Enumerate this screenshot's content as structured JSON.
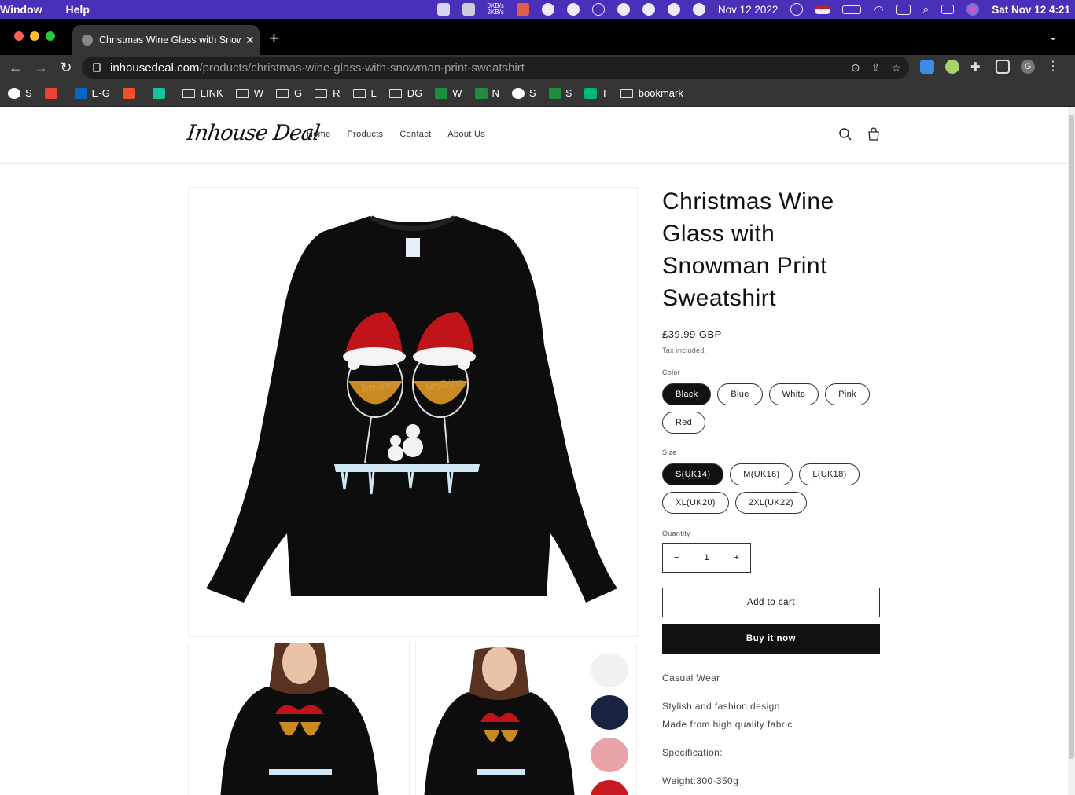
{
  "menubar": {
    "items": [
      "Window",
      "Help"
    ],
    "net_up": "0KB/s",
    "net_down": "2KB/s",
    "date_short": "Nov 12 2022",
    "clock": "Sat Nov 12  4:21"
  },
  "browser": {
    "tab_title": "Christmas Wine Glass with Snowman Print Sweatshirt",
    "tab_close": "✕",
    "new_tab": "+",
    "url_host": "inhousedeal.com",
    "url_path": "/products/christmas-wine-glass-with-snowman-print-sweatshirt",
    "profile_initial": "G",
    "bookmarks": [
      {
        "label": "S",
        "icon": "globe-icon"
      },
      {
        "label": "",
        "icon": "gmail-icon"
      },
      {
        "label": "E-G",
        "icon": "outlook-icon"
      },
      {
        "label": "",
        "icon": "microsoft-icon"
      },
      {
        "label": "",
        "icon": "grammarly-icon"
      },
      {
        "label": "LINK",
        "icon": "folder-icon"
      },
      {
        "label": "W",
        "icon": "folder-icon"
      },
      {
        "label": "G",
        "icon": "folder-icon"
      },
      {
        "label": "R",
        "icon": "folder-icon"
      },
      {
        "label": "L",
        "icon": "folder-icon"
      },
      {
        "label": "DG",
        "icon": "folder-icon"
      },
      {
        "label": "W",
        "icon": "sheet-icon"
      },
      {
        "label": "N",
        "icon": "sheet-icon"
      },
      {
        "label": "S",
        "icon": "globe-icon"
      },
      {
        "label": "$",
        "icon": "sheet-icon"
      },
      {
        "label": "T",
        "icon": "star-icon"
      },
      {
        "label": "bookmark",
        "icon": "folder-icon"
      }
    ]
  },
  "site": {
    "logo": "Inhouse Deal",
    "nav": [
      "Home",
      "Products",
      "Contact",
      "About Us"
    ]
  },
  "product": {
    "title": "Christmas Wine Glass with Snowman Print Sweatshirt",
    "price": "£39.99 GBP",
    "tax_note": "Tax included.",
    "color_label": "Color",
    "colors": [
      "Black",
      "Blue",
      "White",
      "Pink",
      "Red"
    ],
    "selected_color": "Black",
    "size_label": "Size",
    "sizes": [
      "S(UK14)",
      "M(UK16)",
      "L(UK18)",
      "XL(UK20)",
      "2XL(UK22)"
    ],
    "selected_size": "S(UK14)",
    "quantity_label": "Quantity",
    "quantity": "1",
    "minus": "−",
    "plus": "+",
    "add_to_cart": "Add to cart",
    "buy_now": "Buy it now",
    "description": [
      "Casual Wear",
      "Stylish and fashion design",
      "Made from high quality fabric",
      "Specification:",
      "Weight:300-350g"
    ],
    "print_text": "Merry Christmas"
  }
}
